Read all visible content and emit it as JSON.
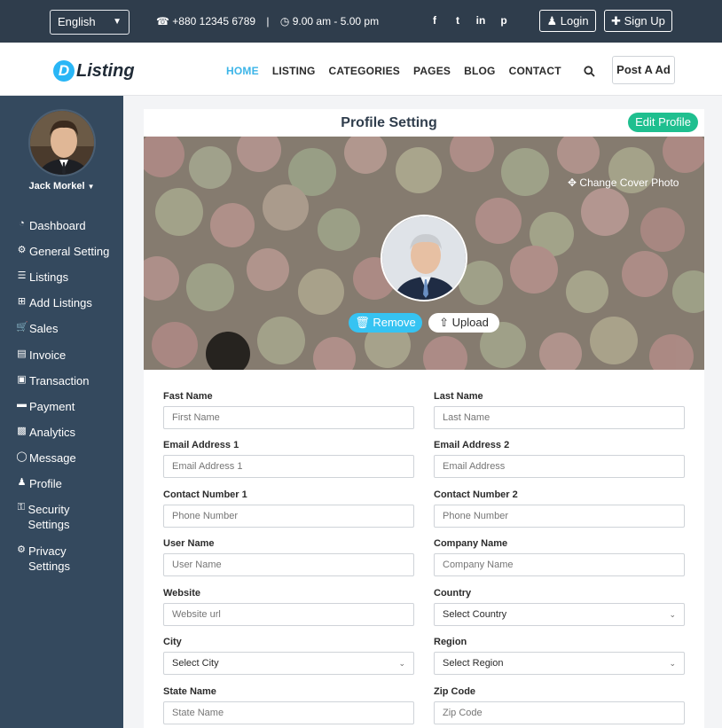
{
  "topbar": {
    "language": "English",
    "phone": "+880 12345 6789",
    "separator": "|",
    "hours": "9.00 am - 5.00 pm",
    "social": [
      "f",
      "t",
      "in",
      "p"
    ],
    "login": "Login",
    "signup": "Sign Up"
  },
  "header": {
    "logo_letter": "D",
    "logo_text": "Listing",
    "nav": [
      "HOME",
      "LISTING",
      "CATEGORIES",
      "PAGES",
      "BLOG",
      "CONTACT"
    ],
    "post_ad": "Post A Ad"
  },
  "sidebar": {
    "user_name": "Jack Morkel",
    "items": [
      {
        "label": "Dashboard",
        "icon": "dashboard-icon"
      },
      {
        "label": "General Setting",
        "icon": "gear-icon"
      },
      {
        "label": "Listings",
        "icon": "list-icon"
      },
      {
        "label": "Add Listings",
        "icon": "plus-square-icon"
      },
      {
        "label": "Sales",
        "icon": "cart-icon"
      },
      {
        "label": "Invoice",
        "icon": "file-icon"
      },
      {
        "label": "Transaction",
        "icon": "money-icon"
      },
      {
        "label": "Payment",
        "icon": "credit-card-icon"
      },
      {
        "label": "Analytics",
        "icon": "bar-chart-icon"
      },
      {
        "label": "Message",
        "icon": "comment-icon"
      },
      {
        "label": "Profile",
        "icon": "user-icon"
      },
      {
        "label": "Security Settings",
        "icon": "lock-icon"
      },
      {
        "label": "Privacy Settings",
        "icon": "gear-icon"
      }
    ]
  },
  "profile": {
    "title": "Profile Setting",
    "edit": "Edit Profile",
    "change_cover": "Change Cover Photo",
    "remove": "Remove",
    "upload": "Upload"
  },
  "form": {
    "fields": [
      {
        "label": "Fast Name",
        "placeholder": "First Name",
        "type": "text"
      },
      {
        "label": "Last Name",
        "placeholder": "Last Name",
        "type": "text"
      },
      {
        "label": "Email Address 1",
        "placeholder": "Email Address 1",
        "type": "text"
      },
      {
        "label": "Email Address 2",
        "placeholder": "Email Address",
        "type": "text"
      },
      {
        "label": "Contact Number 1",
        "placeholder": "Phone Number",
        "type": "text"
      },
      {
        "label": "Contact Number 2",
        "placeholder": "Phone Number",
        "type": "text"
      },
      {
        "label": "User Name",
        "placeholder": "User Name",
        "type": "text"
      },
      {
        "label": "Company Name",
        "placeholder": "Company Name",
        "type": "text"
      },
      {
        "label": "Website",
        "placeholder": "Website url",
        "type": "text"
      },
      {
        "label": "Country",
        "placeholder": "Select Country",
        "type": "select"
      },
      {
        "label": "City",
        "placeholder": "Select City",
        "type": "select"
      },
      {
        "label": "Region",
        "placeholder": "Select Region",
        "type": "select"
      },
      {
        "label": "State Name",
        "placeholder": "State Name",
        "type": "text"
      },
      {
        "label": "Zip Code",
        "placeholder": "Zip Code",
        "type": "text"
      }
    ]
  },
  "colors": {
    "topbar": "#2f3d4c",
    "sidebar": "#34495e",
    "accent": "#3cb5e8",
    "edit_button": "#1fbf8f",
    "remove_button": "#36c3f2"
  }
}
